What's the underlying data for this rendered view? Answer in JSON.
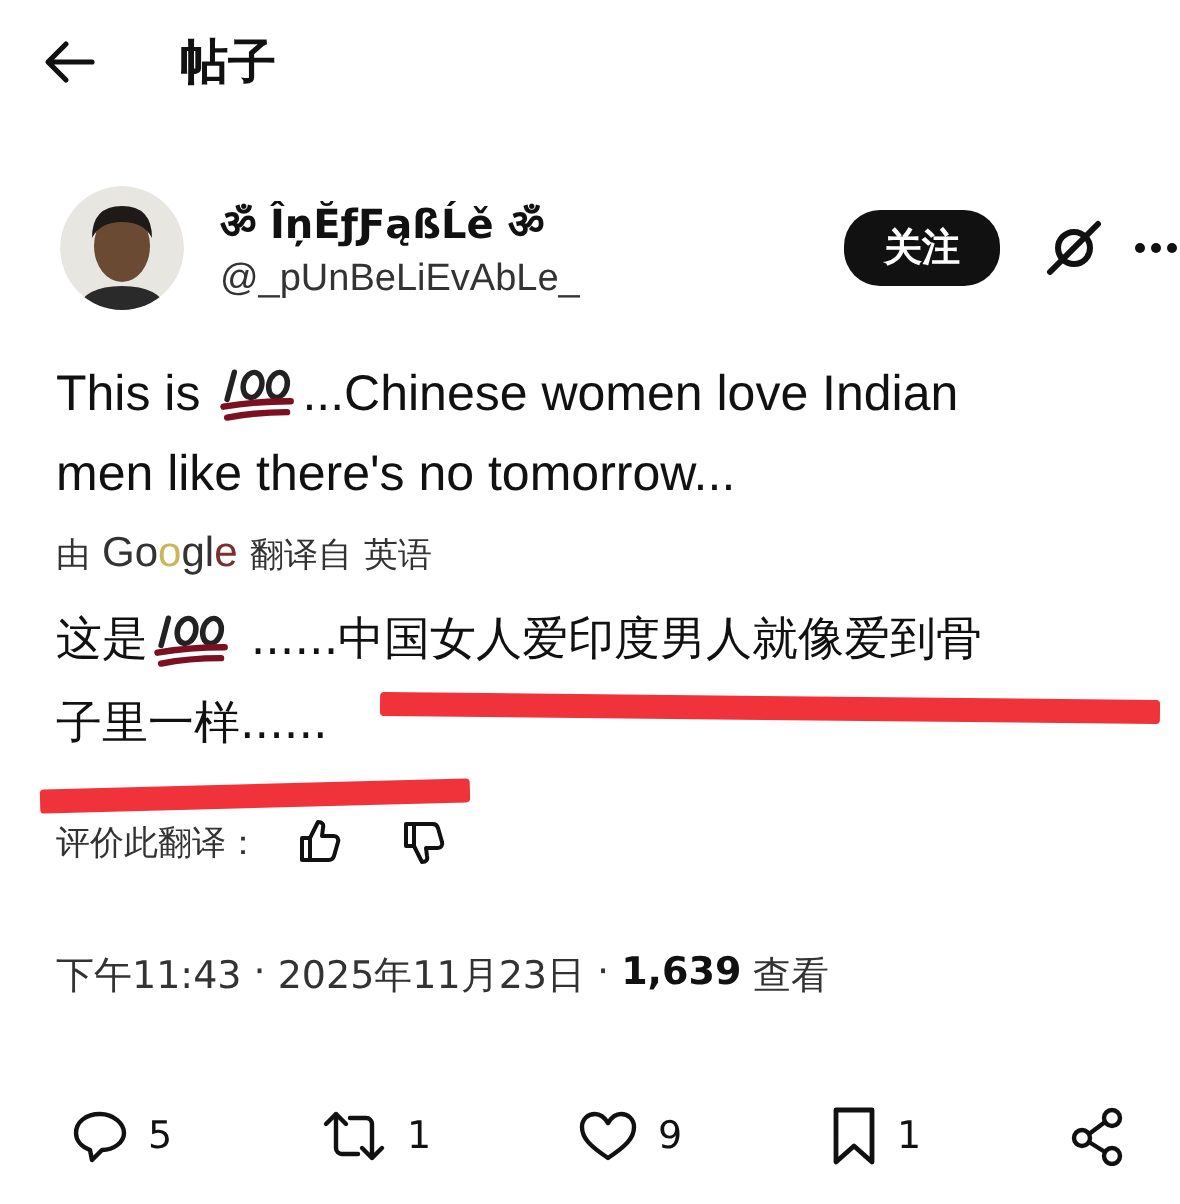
{
  "header": {
    "title": "帖子"
  },
  "author": {
    "name": "ॐ ÎņĔƒƑąßĹě ॐ",
    "handle": "@_pUnBeLiEvAbLe_",
    "follow_label": "关注"
  },
  "post": {
    "lead": "This is",
    "after_icon": "...Chinese women love Indian",
    "line_2": "men like there's no tomorrow..."
  },
  "translation_note": {
    "by": "由",
    "provider": "Google",
    "from": "翻译自",
    "language": "英语"
  },
  "translation": {
    "lead": "这是",
    "after_icon": "......中国女人爱印度男人就像爱到骨",
    "line_2": "子里一样......"
  },
  "rate": {
    "label": "评价此翻译："
  },
  "meta": {
    "time": "下午11:43",
    "separator_1": "·",
    "date": "2025年11月23日",
    "separator_2": "·",
    "views": "1,639",
    "views_label": "查看"
  },
  "actions": [
    {
      "kind": "reply",
      "count": "5"
    },
    {
      "kind": "repost",
      "count": "1"
    },
    {
      "kind": "like",
      "count": "9"
    },
    {
      "kind": "bookmark",
      "count": "1"
    },
    {
      "kind": "share"
    }
  ]
}
